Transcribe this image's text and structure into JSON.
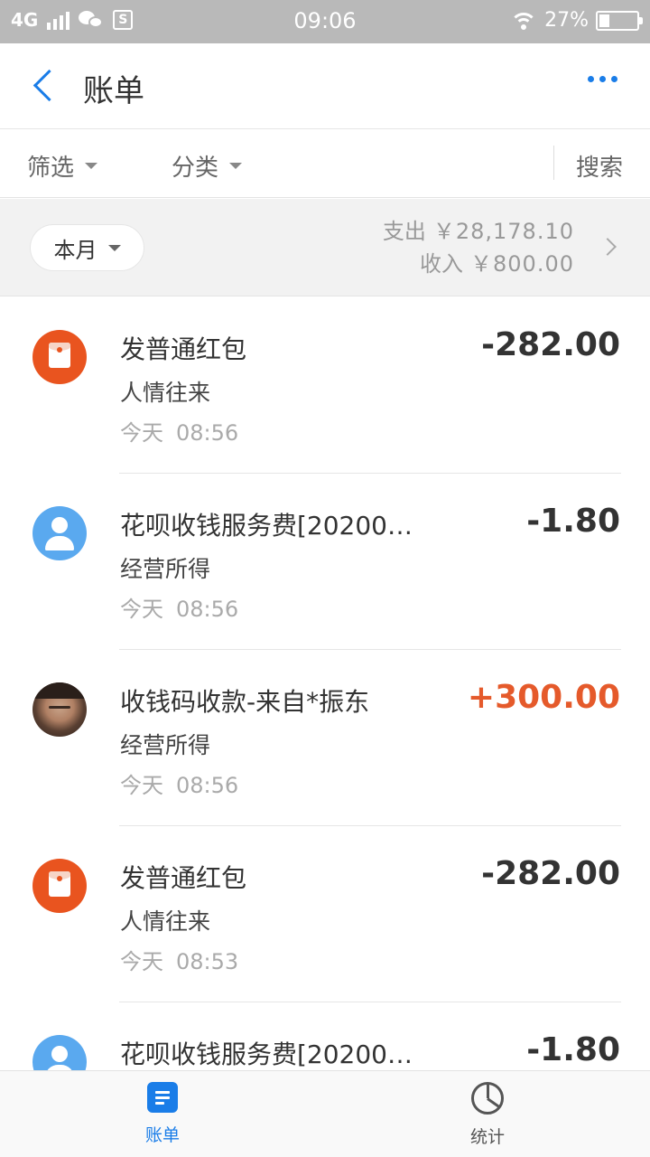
{
  "status_bar": {
    "network": "4G",
    "time": "09:06",
    "battery_percent": "27%",
    "battery_level": 0.27
  },
  "header": {
    "title": "账单"
  },
  "filters": {
    "filter_label": "筛选",
    "category_label": "分类",
    "search_label": "搜索"
  },
  "summary": {
    "period": "本月",
    "expense_label": "支出",
    "expense_value": "￥28,178.10",
    "income_label": "收入",
    "income_value": "￥800.00"
  },
  "transactions": [
    {
      "avatar": "red-envelope-icon",
      "name": "发普通红包",
      "category": "人情往来",
      "day": "今天",
      "time": "08:56",
      "amount": "-282.00",
      "type": "expense"
    },
    {
      "avatar": "user-icon",
      "name": "花呗收钱服务费[20200…",
      "category": "经营所得",
      "day": "今天",
      "time": "08:56",
      "amount": "-1.80",
      "type": "expense"
    },
    {
      "avatar": "user-photo",
      "name": "收钱码收款-来自*振东",
      "category": "经营所得",
      "day": "今天",
      "time": "08:56",
      "amount": "+300.00",
      "type": "income"
    },
    {
      "avatar": "red-envelope-icon",
      "name": "发普通红包",
      "category": "人情往来",
      "day": "今天",
      "time": "08:53",
      "amount": "-282.00",
      "type": "expense"
    },
    {
      "avatar": "user-icon",
      "name": "花呗收钱服务费[20200…",
      "category": "",
      "day": "",
      "time": "",
      "amount": "-1.80",
      "type": "expense"
    }
  ],
  "tabbar": {
    "bills_label": "账单",
    "stats_label": "统计"
  },
  "colors": {
    "accent": "#1a7de8",
    "income": "#e55a2b",
    "expense": "#333333",
    "red_envelope": "#e9541f",
    "user_avatar": "#5aa9ef"
  }
}
